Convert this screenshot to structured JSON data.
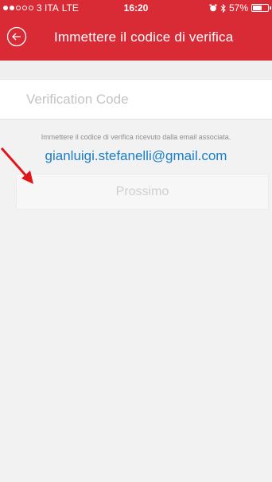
{
  "status_bar": {
    "carrier": "3 ITA",
    "network": "LTE",
    "time": "16:20",
    "battery": "57%",
    "battery_level": 0.57
  },
  "nav": {
    "back_icon": "back-arrow-circle-icon",
    "title": "Immettere il codice di verifica"
  },
  "form": {
    "code_placeholder": "Verification Code",
    "code_value": ""
  },
  "info": {
    "hint": "Immettere il codice di verifica ricevuto dalla email associata.",
    "email": "gianluigi.stefanelli@gmail.com"
  },
  "actions": {
    "next_label": "Prossimo"
  },
  "colors": {
    "brand_red": "#d92b36",
    "email_blue": "#1a7ec5",
    "annotation_red": "#e0161b"
  }
}
